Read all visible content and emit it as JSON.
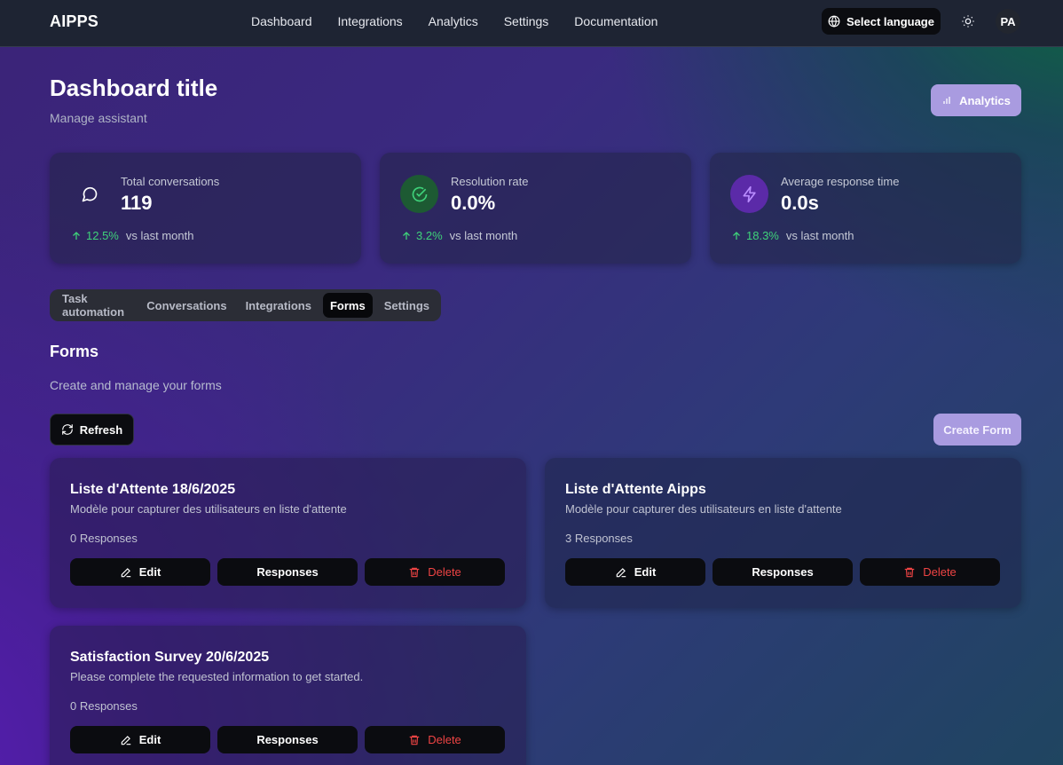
{
  "app": {
    "brand": "AIPPS"
  },
  "nav": {
    "items": [
      "Dashboard",
      "Integrations",
      "Analytics",
      "Settings",
      "Documentation"
    ]
  },
  "header_actions": {
    "language_label": "Select language",
    "avatar_initials": "PA"
  },
  "page": {
    "title": "Dashboard title",
    "subtitle": "Manage assistant",
    "analytics_label": "Analytics"
  },
  "stats": [
    {
      "label": "Total conversations",
      "value": "119",
      "trend": "12.5%",
      "compare": "vs last month",
      "icon": "chat-bubble-icon",
      "icon_bg": "transparent",
      "icon_color": "#ffffff"
    },
    {
      "label": "Resolution rate",
      "value": "0.0%",
      "trend": "3.2%",
      "compare": "vs last month",
      "icon": "check-circle-icon",
      "icon_bg": "#1d5a33",
      "icon_color": "#3fd27a"
    },
    {
      "label": "Average response time",
      "value": "0.0s",
      "trend": "18.3%",
      "compare": "vs last month",
      "icon": "lightning-icon",
      "icon_bg": "#5b2aa8",
      "icon_color": "#b98cff"
    }
  ],
  "tabs": {
    "items": [
      "Task automation",
      "Conversations",
      "Integrations",
      "Forms",
      "Settings"
    ],
    "active": "Forms"
  },
  "forms_section": {
    "title": "Forms",
    "subtitle": "Create and manage your forms",
    "refresh_label": "Refresh",
    "create_label": "Create Form"
  },
  "forms": [
    {
      "title": "Liste d'Attente 18/6/2025",
      "description": "Modèle pour capturer des utilisateurs en liste d'attente",
      "responses": "0 Responses"
    },
    {
      "title": "Liste d'Attente Aipps",
      "description": "Modèle pour capturer des utilisateurs en liste d'attente",
      "responses": "3 Responses"
    },
    {
      "title": "Satisfaction Survey 20/6/2025",
      "description": "Please complete the requested information to get started.",
      "responses": "0 Responses"
    }
  ],
  "card_actions": {
    "edit": "Edit",
    "responses": "Responses",
    "delete": "Delete"
  },
  "colors": {
    "accent": "#a99be0",
    "positive": "#3fd27a",
    "danger": "#ef4444",
    "topbar": "#1e2433"
  }
}
